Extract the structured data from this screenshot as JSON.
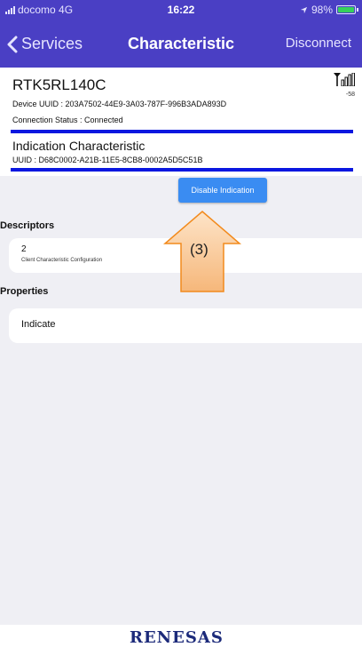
{
  "status_bar": {
    "carrier": "docomo 4G",
    "time": "16:22",
    "battery_text": "98%",
    "battery_level": 0.98
  },
  "nav": {
    "back_label": "Services",
    "title": "Characteristic",
    "right_action": "Disconnect"
  },
  "device": {
    "name": "RTK5RL140C",
    "rssi": "-58",
    "uuid_line": "Device UUID : 203A7502-44E9-3A03-787F-996B3ADA893D",
    "status_line": "Connection Status :  Connected"
  },
  "characteristic": {
    "name": "Indication Characteristic",
    "uuid_line": "UUID : D68C0002-A21B-11E5-8CB8-0002A5D5C51B"
  },
  "action_button": "Disable Indication",
  "descriptors": {
    "title": "Descriptors",
    "items": [
      {
        "id": "2",
        "name": "Client Characteristic Configuration"
      }
    ]
  },
  "properties": {
    "title": "Properties",
    "items": [
      "Indicate"
    ]
  },
  "annotation": {
    "label": "(3)"
  },
  "footer": {
    "logo_text": "RENESAS"
  },
  "colors": {
    "nav_bg": "#4a3fc4",
    "accent_line": "#0a17e0",
    "button": "#3a8cf2",
    "callout_fill": "#f9c99a",
    "callout_stroke": "#f28a1c"
  }
}
